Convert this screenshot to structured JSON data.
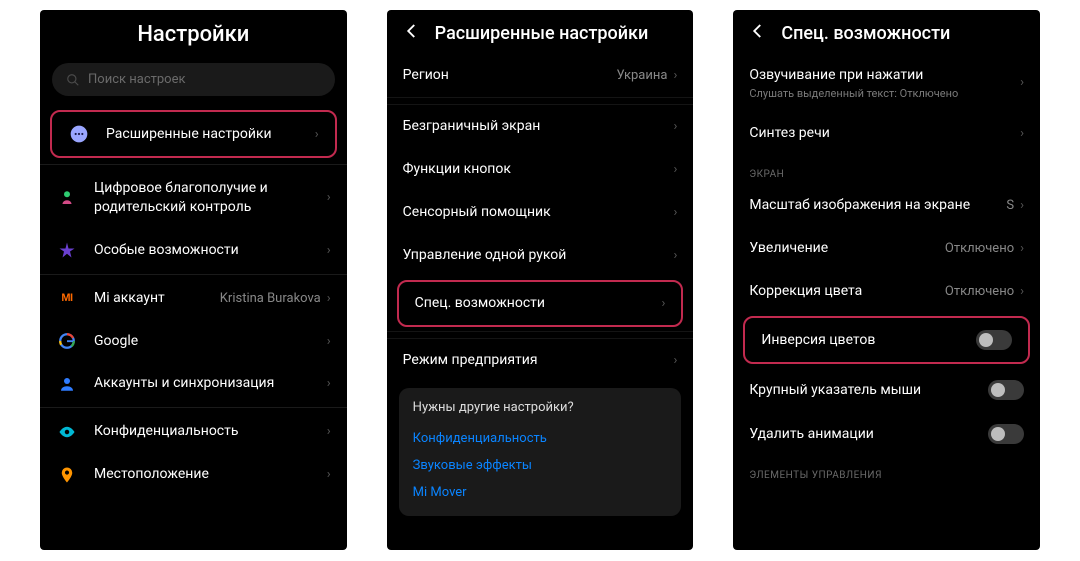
{
  "panel1": {
    "title": "Настройки",
    "search_placeholder": "Поиск настроек",
    "advanced": "Расширенные настройки",
    "wellbeing": "Цифровое благополучие и родительский контроль",
    "special": "Особые возможности",
    "mi_account": "Mi аккаунт",
    "mi_account_value": "Kristina Burakova",
    "google": "Google",
    "accounts_sync": "Аккаунты и синхронизация",
    "privacy": "Конфиденциальность",
    "location": "Местоположение"
  },
  "panel2": {
    "title": "Расширенные настройки",
    "region": "Регион",
    "region_value": "Украина",
    "fullscreen": "Безграничный экран",
    "buttons": "Функции кнопок",
    "touch_assistant": "Сенсорный помощник",
    "one_hand": "Управление одной рукой",
    "accessibility": "Спец. возможности",
    "enterprise": "Режим предприятия",
    "card_q": "Нужны другие настройки?",
    "card_privacy": "Конфиденциальность",
    "card_sound": "Звуковые эффекты",
    "card_mover": "Mi Mover"
  },
  "panel3": {
    "title": "Спец. возможности",
    "speak_on_tap": "Озвучивание при нажатии",
    "speak_on_tap_sub": "Слушать выделенный текст: Отключено",
    "tts": "Синтез речи",
    "section_screen": "ЭКРАН",
    "display_scale": "Масштаб изображения на экране",
    "display_scale_value": "S",
    "magnification": "Увеличение",
    "magnification_value": "Отключено",
    "color_correction": "Коррекция цвета",
    "color_correction_value": "Отключено",
    "color_inversion": "Инверсия цветов",
    "large_pointer": "Крупный указатель мыши",
    "remove_animations": "Удалить анимации",
    "section_controls": "ЭЛЕМЕНТЫ УПРАВЛЕНИЯ"
  }
}
